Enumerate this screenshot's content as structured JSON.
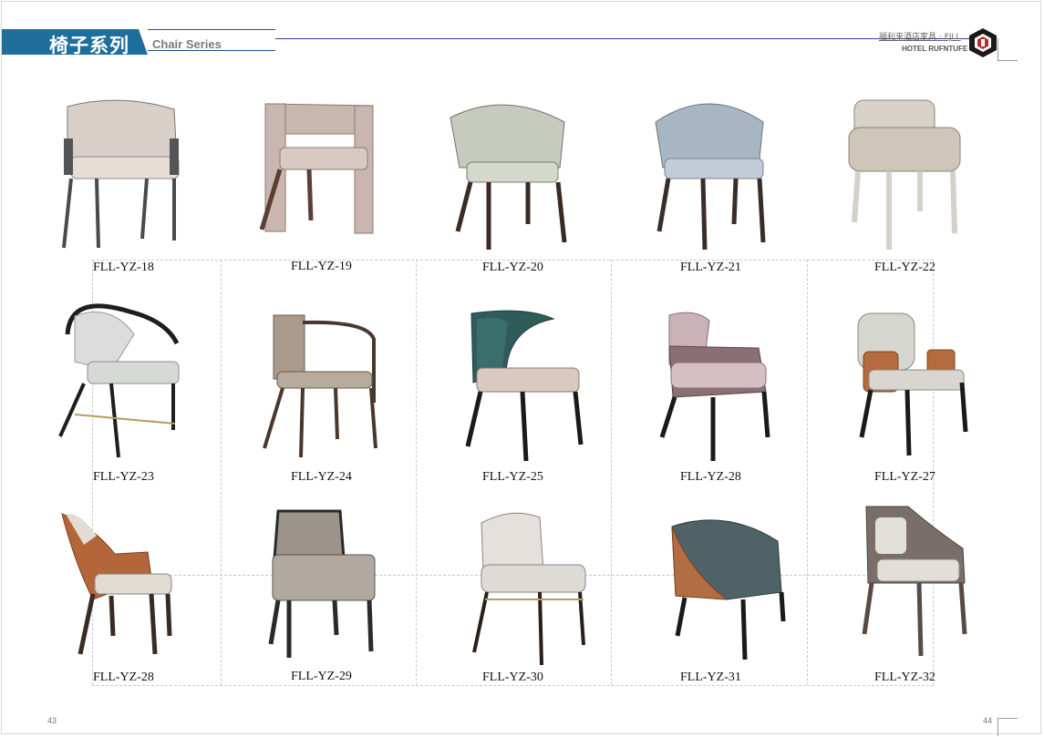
{
  "header": {
    "title_cn": "椅子系列",
    "title_en": "Chair Series",
    "brand_cn": "福利来酒店家具 · FJLL",
    "brand_en": "HOTEL RUFNTUFE"
  },
  "pages": {
    "left": "43",
    "right": "44"
  },
  "colors": {
    "band": "#1f6f9c",
    "rule": "#2a4a8a"
  },
  "chairs": [
    {
      "code": "FLL-YZ-18",
      "icon": "armchair-icon"
    },
    {
      "code": "FLL-YZ-19",
      "icon": "armchair-icon"
    },
    {
      "code": "FLL-YZ-20",
      "icon": "armchair-icon"
    },
    {
      "code": "FLL-YZ-21",
      "icon": "armchair-icon"
    },
    {
      "code": "FLL-YZ-22",
      "icon": "armchair-icon"
    },
    {
      "code": "FLL-YZ-23",
      "icon": "armchair-icon"
    },
    {
      "code": "FLL-YZ-24",
      "icon": "armchair-icon"
    },
    {
      "code": "FLL-YZ-25",
      "icon": "chair-icon"
    },
    {
      "code": "FLL-YZ-28",
      "icon": "chair-icon"
    },
    {
      "code": "FLL-YZ-27",
      "icon": "armchair-icon"
    },
    {
      "code": "FLL-YZ-28",
      "icon": "chair-icon"
    },
    {
      "code": "FLL-YZ-29",
      "icon": "chair-icon"
    },
    {
      "code": "FLL-YZ-30",
      "icon": "chair-icon"
    },
    {
      "code": "FLL-YZ-31",
      "icon": "armchair-icon"
    },
    {
      "code": "FLL-YZ-32",
      "icon": "armchair-icon"
    }
  ]
}
